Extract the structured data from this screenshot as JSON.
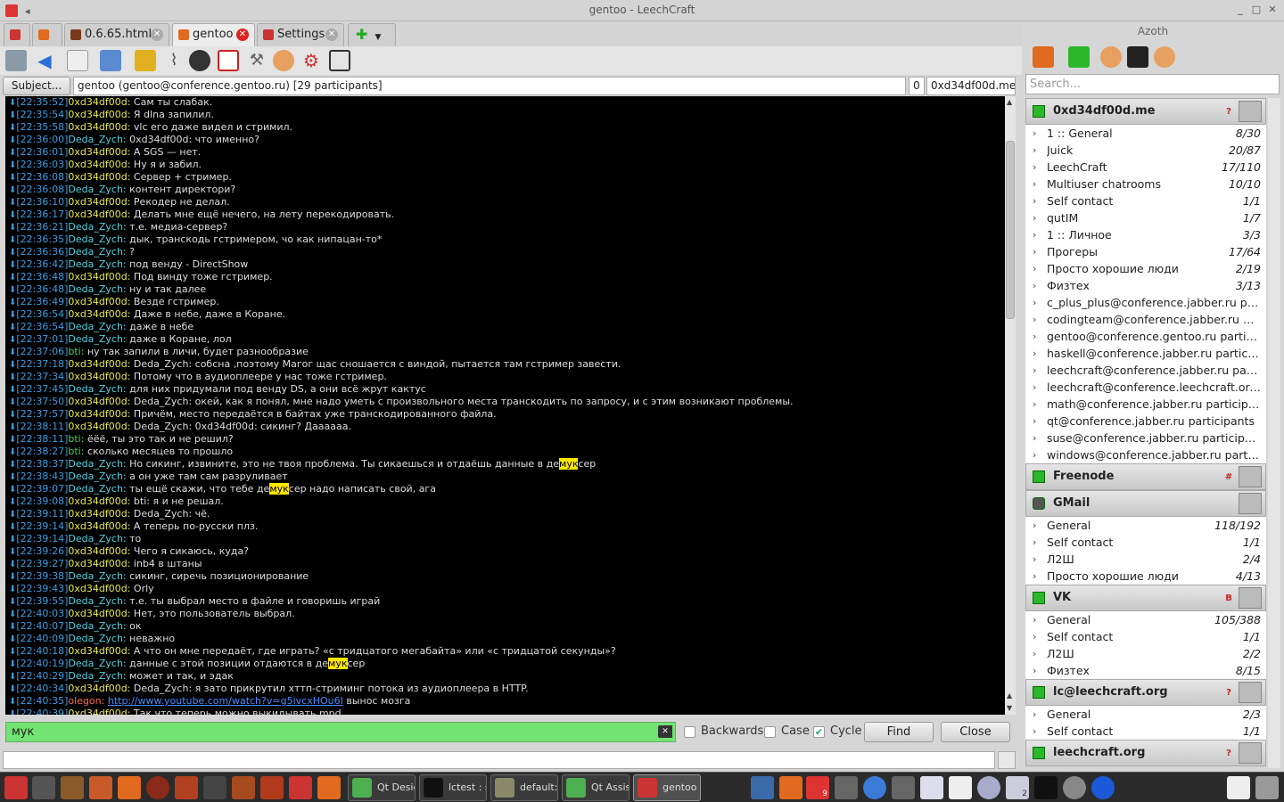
{
  "window": {
    "title": "gentoo - LeechCraft"
  },
  "tabs": [
    {
      "label": ""
    },
    {
      "label": ""
    },
    {
      "label": "0.6.65.html"
    },
    {
      "label": "gentoo"
    },
    {
      "label": "Settings"
    }
  ],
  "subject": {
    "button_label": "Subject...",
    "text": "gentoo (gentoo@conference.gentoo.ru) [29 participants]",
    "count": "0",
    "nick": "0xd34df00d.me"
  },
  "messages": [
    {
      "ts": "[22:35:52]",
      "nick": "0xd34df00d",
      "cls": "n-0x",
      "text": "Сам ты слабак."
    },
    {
      "ts": "[22:35:54]",
      "nick": "0xd34df00d",
      "cls": "n-0x",
      "text": "Я dlna запилил."
    },
    {
      "ts": "[22:35:58]",
      "nick": "0xd34df00d",
      "cls": "n-0x",
      "text": "vlc его даже видел и стримил."
    },
    {
      "ts": "[22:36:00]",
      "nick": "Deda_Zych",
      "cls": "n-deda",
      "text": "0xd34df00d: что именно?"
    },
    {
      "ts": "[22:36:01]",
      "nick": "0xd34df00d",
      "cls": "n-0x",
      "text": "А SGS — нет."
    },
    {
      "ts": "[22:36:03]",
      "nick": "0xd34df00d",
      "cls": "n-0x",
      "text": "Ну я и забил."
    },
    {
      "ts": "[22:36:08]",
      "nick": "0xd34df00d",
      "cls": "n-0x",
      "text": "Сервер + стример."
    },
    {
      "ts": "[22:36:08]",
      "nick": "Deda_Zych",
      "cls": "n-deda",
      "text": "контент директори?"
    },
    {
      "ts": "[22:36:10]",
      "nick": "0xd34df00d",
      "cls": "n-0x",
      "text": "Рекодер не делал."
    },
    {
      "ts": "[22:36:17]",
      "nick": "0xd34df00d",
      "cls": "n-0x",
      "text": "Делать мне ещё нечего, на лету перекодировать."
    },
    {
      "ts": "[22:36:21]",
      "nick": "Deda_Zych",
      "cls": "n-deda",
      "text": "т.е. медиа-сервер?"
    },
    {
      "ts": "[22:36:35]",
      "nick": "Deda_Zych",
      "cls": "n-deda",
      "text": "дык, транскодь гстримером, чо как нипацан-то*"
    },
    {
      "ts": "[22:36:36]",
      "nick": "Deda_Zych",
      "cls": "n-deda",
      "text": "?"
    },
    {
      "ts": "[22:36:42]",
      "nick": "Deda_Zych",
      "cls": "n-deda",
      "text": "под венду - DirectShow"
    },
    {
      "ts": "[22:36:48]",
      "nick": "0xd34df00d",
      "cls": "n-0x",
      "text": "Под винду тоже гстример."
    },
    {
      "ts": "[22:36:48]",
      "nick": "Deda_Zych",
      "cls": "n-deda",
      "text": "ну и так далее"
    },
    {
      "ts": "[22:36:49]",
      "nick": "0xd34df00d",
      "cls": "n-0x",
      "text": "Везде гстример."
    },
    {
      "ts": "[22:36:54]",
      "nick": "0xd34df00d",
      "cls": "n-0x",
      "text": "Даже в небе, даже в Коране."
    },
    {
      "ts": "[22:36:54]",
      "nick": "Deda_Zych",
      "cls": "n-deda",
      "text": "даже в небе"
    },
    {
      "ts": "[22:37:01]",
      "nick": "Deda_Zych",
      "cls": "n-deda",
      "text": "даже в Коране, лол"
    },
    {
      "ts": "[22:37:06]",
      "nick": "bti",
      "cls": "n-bti",
      "text": "ну так запили в личи, будет разнообразие"
    },
    {
      "ts": "[22:37:18]",
      "nick": "0xd34df00d",
      "cls": "n-0x",
      "text": "Deda_Zych: собсна ,поэтому Магог щас сношается с виндой, пытается там гстример завести."
    },
    {
      "ts": "[22:37:34]",
      "nick": "0xd34df00d",
      "cls": "n-0x",
      "text": "Потому что в аудиоплеере у нас тоже гстример."
    },
    {
      "ts": "[22:37:45]",
      "nick": "Deda_Zych",
      "cls": "n-deda",
      "text": "для них придумали под венду DS, а они всё жрут кактус"
    },
    {
      "ts": "[22:37:50]",
      "nick": "0xd34df00d",
      "cls": "n-0x",
      "text": "Deda_Zych: окей, как я понял, мне надо уметь с произвольного места транскодить по запросу, и с этим возникают проблемы."
    },
    {
      "ts": "[22:37:57]",
      "nick": "0xd34df00d",
      "cls": "n-0x",
      "text": "Причём, место передаётся в байтах уже транскодированного файла."
    },
    {
      "ts": "[22:38:11]",
      "nick": "0xd34df00d",
      "cls": "n-0x",
      "text": "Deda_Zych: 0xd34df00d: сикинг? Даааааа."
    },
    {
      "ts": "[22:38:11]",
      "nick": "bti",
      "cls": "n-bti",
      "text": "ёёё, ты это так и не решил?"
    },
    {
      "ts": "[22:38:27]",
      "nick": "bti",
      "cls": "n-bti",
      "text": "сколько месяцев то прошло"
    },
    {
      "ts": "[22:38:37]",
      "nick": "Deda_Zych",
      "cls": "n-deda",
      "pre": "Но сикинг, извините, это не твоя проблема. Ты сикаешься и отдаёшь данные в де",
      "hl": "мук",
      "post": "сер"
    },
    {
      "ts": "[22:38:43]",
      "nick": "Deda_Zych",
      "cls": "n-deda",
      "text": "а он уже там сам разруливает"
    },
    {
      "ts": "[22:39:07]",
      "nick": "Deda_Zych",
      "cls": "n-deda",
      "pre": "ты ещё  скажи, что тебе де",
      "hl": "мук",
      "post": "сер надо написать свой, ага"
    },
    {
      "ts": "[22:39:08]",
      "nick": "0xd34df00d",
      "cls": "n-0x",
      "text": "bti: я и не решал."
    },
    {
      "ts": "[22:39:11]",
      "nick": "0xd34df00d",
      "cls": "n-0x",
      "text": "Deda_Zych: чё."
    },
    {
      "ts": "[22:39:14]",
      "nick": "0xd34df00d",
      "cls": "n-0x",
      "text": "А теперь по-русски плз."
    },
    {
      "ts": "[22:39:14]",
      "nick": "Deda_Zych",
      "cls": "n-deda",
      "text": "то"
    },
    {
      "ts": "[22:39:26]",
      "nick": "0xd34df00d",
      "cls": "n-0x",
      "text": "Чего я сикаюсь, куда?"
    },
    {
      "ts": "[22:39:27]",
      "nick": "0xd34df00d",
      "cls": "n-0x",
      "text": "inb4 в штаны"
    },
    {
      "ts": "[22:39:38]",
      "nick": "Deda_Zych",
      "cls": "n-deda",
      "text": "сикинг, сиречь позиционирование"
    },
    {
      "ts": "[22:39:43]",
      "nick": "0xd34df00d",
      "cls": "n-0x",
      "text": "Orly"
    },
    {
      "ts": "[22:39:55]",
      "nick": "Deda_Zych",
      "cls": "n-deda",
      "text": "т.е. ты выбрал место в файле и говоришь играй"
    },
    {
      "ts": "[22:40:03]",
      "nick": "0xd34df00d",
      "cls": "n-0x",
      "text": "Нет, это пользователь выбрал."
    },
    {
      "ts": "[22:40:07]",
      "nick": "Deda_Zych",
      "cls": "n-deda",
      "text": "ок"
    },
    {
      "ts": "[22:40:09]",
      "nick": "Deda_Zych",
      "cls": "n-deda",
      "text": "неважно"
    },
    {
      "ts": "[22:40:18]",
      "nick": "0xd34df00d",
      "cls": "n-0x",
      "text": "А что он мне передаёт, где играть? «с тридцатого мегабайта» или «с тридцатой секунды»?"
    },
    {
      "ts": "[22:40:19]",
      "nick": "Deda_Zych",
      "cls": "n-deda",
      "pre": "данные с этой позиции отдаются в де",
      "hl": "мук",
      "post": "сер"
    },
    {
      "ts": "[22:40:29]",
      "nick": "Deda_Zych",
      "cls": "n-deda",
      "text": "может и так, и эдак"
    },
    {
      "ts": "[22:40:34]",
      "nick": "0xd34df00d",
      "cls": "n-0x",
      "text": "Deda_Zych: я зато прикрутил хттп-стриминг потока из аудиоплеера в HTTP."
    },
    {
      "ts": "[22:40:35]",
      "nick": "olegon",
      "cls": "n-oleg",
      "link": "http://www.youtube.com/watch?v=g5ivcxHOu6I",
      "post": " вынос мозга"
    },
    {
      "ts": "[22:40:39]",
      "nick": "0xd34df00d",
      "cls": "n-0x",
      "text": "Так что теперь можно выкидывать mpd."
    }
  ],
  "find": {
    "query": "мук",
    "backwards_label": "Backwards",
    "case_label": "Case",
    "cycle_label": "Cycle",
    "backwards": false,
    "case": false,
    "cycle": true,
    "find_label": "Find",
    "close_label": "Close"
  },
  "azoth": {
    "title": "Azoth",
    "search_placeholder": "Search...",
    "accounts": [
      {
        "name": "0xd34df00d.me",
        "badge": "?",
        "groups": [
          {
            "name": "1 :: General",
            "count": "8/30"
          },
          {
            "name": "Juick",
            "count": "20/87"
          },
          {
            "name": "LeechCraft",
            "count": "17/110"
          },
          {
            "name": "Multiuser chatrooms",
            "count": "10/10"
          },
          {
            "name": "Self contact",
            "count": "1/1"
          },
          {
            "name": "qutIM",
            "count": "1/7"
          },
          {
            "name": "1 :: Личное",
            "count": "3/3"
          },
          {
            "name": "Прогеры",
            "count": "17/64"
          },
          {
            "name": "Просто хорошие люди",
            "count": "2/19"
          },
          {
            "name": "Физтех",
            "count": "3/13"
          },
          {
            "name": "c_plus_plus@conference.jabber.ru participants",
            "count": ""
          },
          {
            "name": "codingteam@conference.jabber.ru participants",
            "count": ""
          },
          {
            "name": "gentoo@conference.gentoo.ru participants",
            "count": ""
          },
          {
            "name": "haskell@conference.jabber.ru participants",
            "count": ""
          },
          {
            "name": "leechcraft@conference.jabber.ru participants",
            "count": ""
          },
          {
            "name": "leechcraft@conference.leechcraft.org participants",
            "count": ""
          },
          {
            "name": "math@conference.jabber.ru participants",
            "count": ""
          },
          {
            "name": "qt@conference.jabber.ru participants",
            "count": ""
          },
          {
            "name": "suse@conference.jabber.ru participants",
            "count": ""
          },
          {
            "name": "windows@conference.jabber.ru participants",
            "count": ""
          }
        ]
      },
      {
        "name": "Freenode",
        "badge": "#",
        "groups": []
      },
      {
        "name": "GMail",
        "badge": "",
        "groups": [
          {
            "name": "General",
            "count": "118/192"
          },
          {
            "name": "Self contact",
            "count": "1/1"
          },
          {
            "name": "Л2Ш",
            "count": "2/4"
          },
          {
            "name": "Просто хорошие люди",
            "count": "4/13"
          }
        ]
      },
      {
        "name": "VK",
        "badge": "B",
        "groups": [
          {
            "name": "General",
            "count": "105/388"
          },
          {
            "name": "Self contact",
            "count": "1/1"
          },
          {
            "name": "Л2Ш",
            "count": "2/2"
          },
          {
            "name": "Физтех",
            "count": "8/15"
          }
        ]
      },
      {
        "name": "lc@leechcraft.org",
        "badge": "?",
        "groups": [
          {
            "name": "General",
            "count": "2/3"
          },
          {
            "name": "Self contact",
            "count": "1/1"
          }
        ]
      },
      {
        "name": "leechcraft.org",
        "badge": "?",
        "groups": []
      }
    ]
  },
  "taskbar": {
    "tasks": [
      {
        "label": "Qt Desig..."
      },
      {
        "label": "lctest : s..."
      },
      {
        "label": "default: ..."
      },
      {
        "label": "Qt Assis..."
      },
      {
        "label": "gentoo -..."
      }
    ],
    "mail_count": "9",
    "chat_count": "2"
  }
}
